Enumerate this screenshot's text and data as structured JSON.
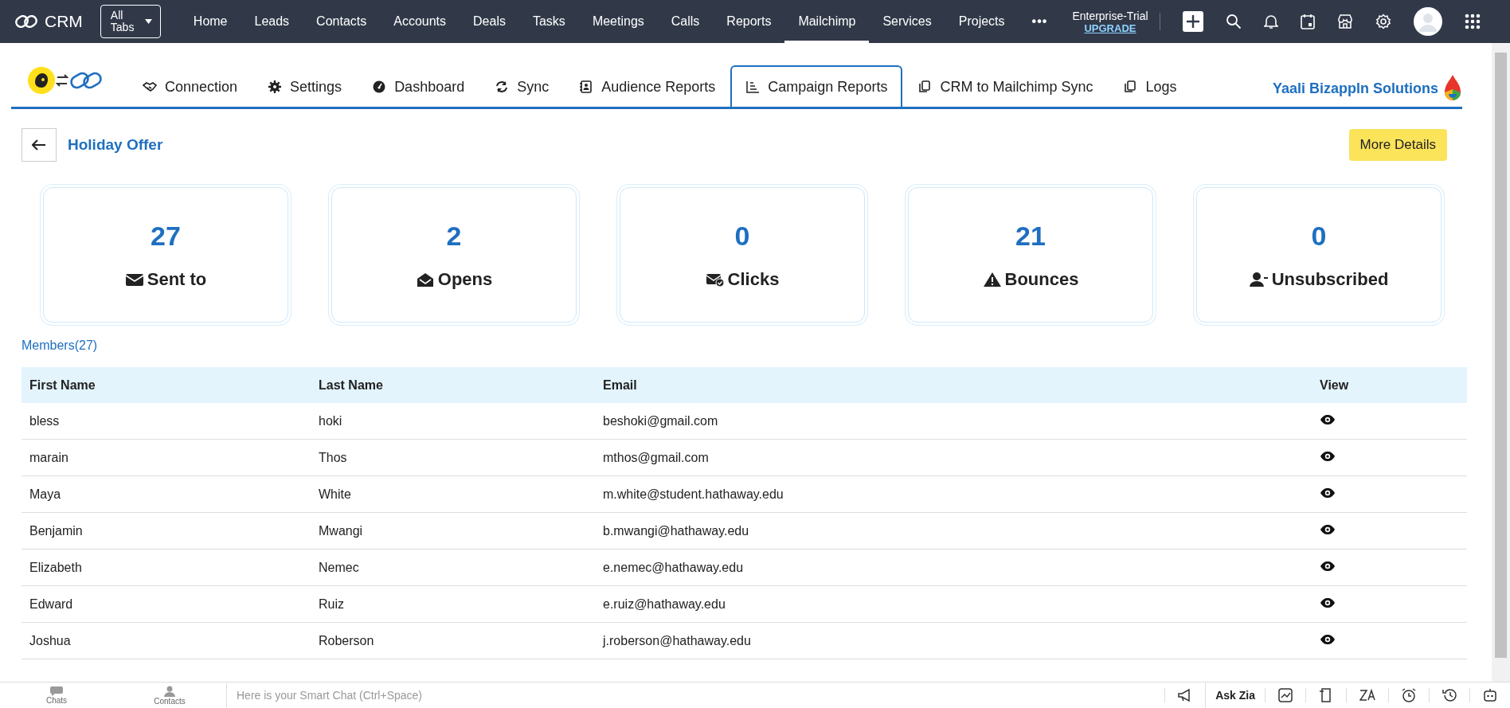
{
  "top_nav": {
    "brand": "CRM",
    "all_tabs": "All Tabs",
    "more": "•••",
    "plan": "Enterprise-Trial",
    "upgrade": "UPGRADE",
    "items": [
      {
        "label": "Home",
        "selected": false
      },
      {
        "label": "Leads",
        "selected": false
      },
      {
        "label": "Contacts",
        "selected": false
      },
      {
        "label": "Accounts",
        "selected": false
      },
      {
        "label": "Deals",
        "selected": false
      },
      {
        "label": "Tasks",
        "selected": false
      },
      {
        "label": "Meetings",
        "selected": false
      },
      {
        "label": "Calls",
        "selected": false
      },
      {
        "label": "Reports",
        "selected": false
      },
      {
        "label": "Mailchimp",
        "selected": true
      },
      {
        "label": "Services",
        "selected": false
      },
      {
        "label": "Projects",
        "selected": false
      }
    ]
  },
  "sub_nav": {
    "company": "Yaali Bizappln Solutions",
    "tabs": [
      {
        "label": "Connection",
        "kind": "handshake",
        "selected": false
      },
      {
        "label": "Settings",
        "kind": "gear",
        "selected": false
      },
      {
        "label": "Dashboard",
        "kind": "gauge",
        "selected": false
      },
      {
        "label": "Sync",
        "kind": "sync",
        "selected": false
      },
      {
        "label": "Audience Reports",
        "kind": "contact",
        "selected": false
      },
      {
        "label": "Campaign Reports",
        "kind": "chart",
        "selected": true
      },
      {
        "label": "CRM to Mailchimp Sync",
        "kind": "copy",
        "selected": false
      },
      {
        "label": "Logs",
        "kind": "copy",
        "selected": false
      }
    ]
  },
  "campaign": {
    "title": "Holiday Offer",
    "more_details": "More Details"
  },
  "stats": [
    {
      "value": "27",
      "label": "Sent to",
      "kind": "envelope"
    },
    {
      "value": "2",
      "label": "Opens",
      "kind": "open-envelope"
    },
    {
      "value": "0",
      "label": "Clicks",
      "kind": "envelope-check"
    },
    {
      "value": "21",
      "label": "Bounces",
      "kind": "warning"
    },
    {
      "value": "0",
      "label": "Unsubscribed",
      "kind": "user-minus"
    }
  ],
  "members_link": "Members(27)",
  "table": {
    "columns": [
      "First Name",
      "Last Name",
      "Email",
      "View"
    ],
    "rows": [
      {
        "first_name": "bless",
        "last_name": "hoki",
        "email": "beshoki@gmail.com"
      },
      {
        "first_name": "marain",
        "last_name": "Thos",
        "email": "mthos@gmail.com"
      },
      {
        "first_name": "Maya",
        "last_name": "White",
        "email": "m.white@student.hathaway.edu"
      },
      {
        "first_name": "Benjamin",
        "last_name": "Mwangi",
        "email": "b.mwangi@hathaway.edu"
      },
      {
        "first_name": "Elizabeth",
        "last_name": "Nemec",
        "email": "e.nemec@hathaway.edu"
      },
      {
        "first_name": "Edward",
        "last_name": "Ruiz",
        "email": "e.ruiz@hathaway.edu"
      },
      {
        "first_name": "Joshua",
        "last_name": "Roberson",
        "email": "j.roberson@hathaway.edu"
      }
    ]
  },
  "bottom_bar": {
    "chats": "Chats",
    "contacts": "Contacts",
    "chat_placeholder": "Here is your Smart Chat (Ctrl+Space)",
    "ask_zia": "Ask Zia"
  }
}
